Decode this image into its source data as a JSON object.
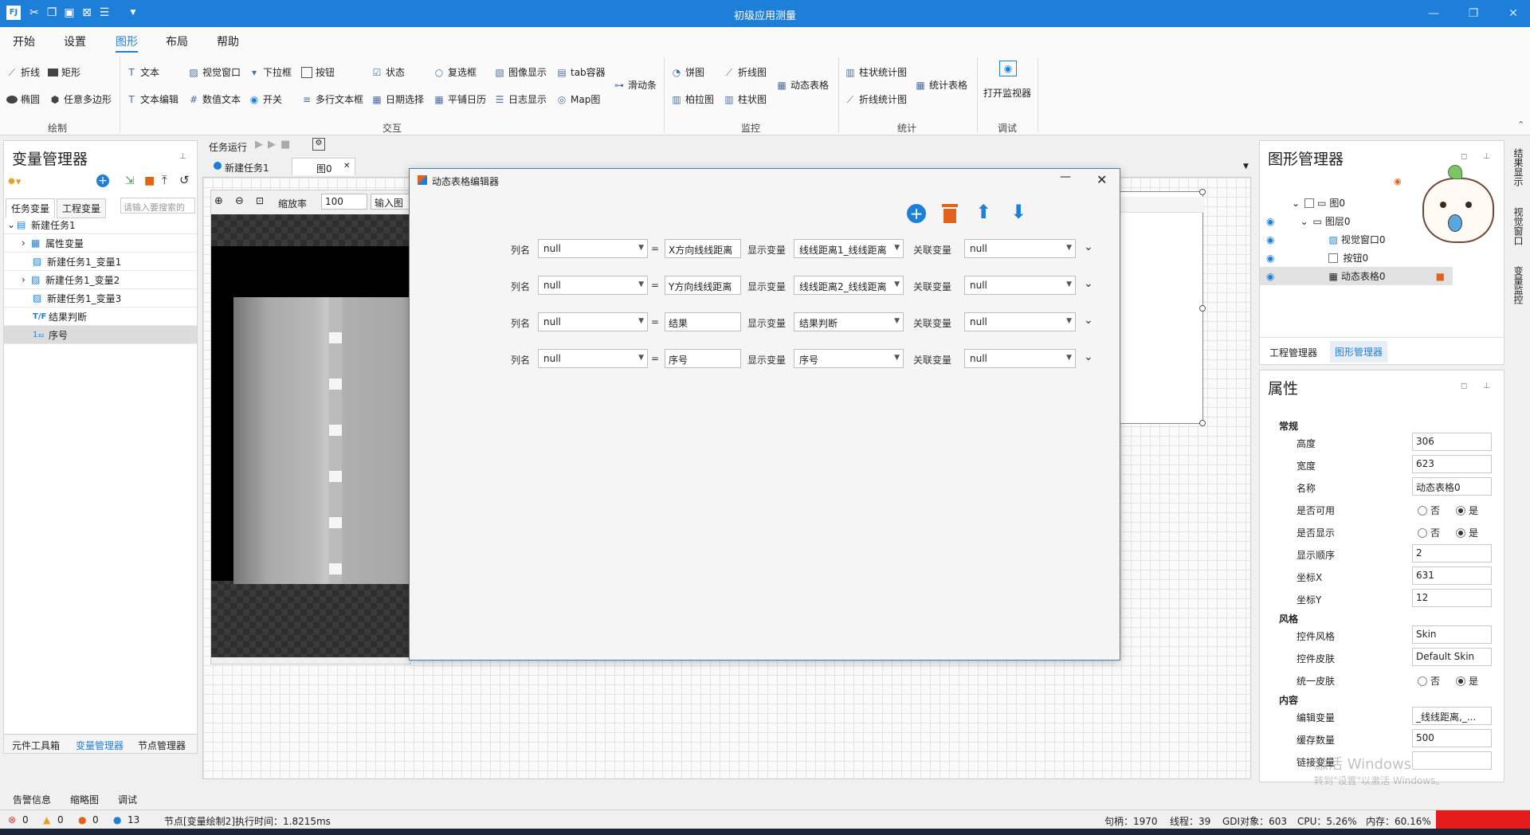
{
  "window": {
    "title": "初级应用测量"
  },
  "menu": [
    "开始",
    "设置",
    "图形",
    "布局",
    "帮助"
  ],
  "ribbon": {
    "draw": {
      "items": [
        "折线",
        "矩形",
        "椭圆",
        "任意多边形"
      ],
      "label": "绘制"
    },
    "interact": {
      "items": [
        "文本",
        "视觉窗口",
        "下拉框",
        "按钮",
        "状态",
        "复选框",
        "图像显示",
        "tab容器",
        "滑动条",
        "文本编辑",
        "数值文本",
        "开关",
        "多行文本框",
        "日期选择",
        "平铺日历",
        "日志显示",
        "Map图"
      ],
      "label": "交互"
    },
    "monitor": {
      "items": [
        "饼图",
        "折线图",
        "动态表格",
        "柏拉图",
        "柱状图"
      ],
      "label": "监控"
    },
    "stats": {
      "items": [
        "柱状统计图",
        "统计表格",
        "折线统计图"
      ],
      "label": "统计"
    },
    "debug": {
      "items": [
        "打开监视器"
      ],
      "label": "调试"
    }
  },
  "left_panel": {
    "title": "变量管理器",
    "tabs": [
      "任务变量",
      "工程变量"
    ],
    "search_placeholder": "请输入要搜索的",
    "tree": [
      "新建任务1",
      "属性变量",
      "新建任务1_变量1",
      "新建任务1_变量2",
      "新建任务1_变量3",
      "结果判断",
      "序号"
    ],
    "bottom_tabs": [
      "元件工具箱",
      "变量管理器",
      "节点管理器"
    ]
  },
  "center": {
    "toolbar_label": "任务运行",
    "doc_tabs": [
      "新建任务1",
      "图0"
    ],
    "zoom_label": "缩放率",
    "zoom_value": "100",
    "input_label": "输入图"
  },
  "dialog": {
    "title": "动态表格编辑器",
    "col_label": "列名",
    "eq": "=",
    "display_label": "显示变量",
    "assoc_label": "关联变量",
    "rows": [
      {
        "colname": "null",
        "text": "X方向线线距离",
        "display": "线线距离1_线线距离",
        "assoc": "null"
      },
      {
        "colname": "null",
        "text": "Y方向线线距离",
        "display": "线线距离2_线线距离",
        "assoc": "null"
      },
      {
        "colname": "null",
        "text": "结果",
        "display": "结果判断",
        "assoc": "null"
      },
      {
        "colname": "null",
        "text": "序号",
        "display": "序号",
        "assoc": "null"
      }
    ]
  },
  "right_panel": {
    "title": "图形管理器",
    "tree": [
      "图0",
      "图层0",
      "视觉窗口0",
      "按钮0",
      "动态表格0"
    ],
    "tabs": [
      "工程管理器",
      "图形管理器"
    ],
    "side_tabs": [
      "结果显示",
      "视觉窗口",
      "变量监控"
    ]
  },
  "props": {
    "title": "属性",
    "general": "常规",
    "height_label": "高度",
    "height": "306",
    "width_label": "宽度",
    "width": "623",
    "name_label": "名称",
    "name": "动态表格0",
    "enabled_label": "是否可用",
    "visible_label": "是否显示",
    "order_label": "显示顺序",
    "order": "2",
    "x_label": "坐标X",
    "x": "631",
    "y_label": "坐标Y",
    "y": "12",
    "no": "否",
    "yes": "是",
    "style": "风格",
    "ctrl_style_label": "控件风格",
    "ctrl_style": "Skin",
    "skin_label": "控件皮肤",
    "skin": "Default Skin",
    "unify_label": "统一皮肤",
    "content": "内容",
    "edit_var_label": "编辑变量",
    "edit_var": "_线线距离,_...",
    "cache_label": "缓存数量",
    "cache": "500",
    "link_label": "链接变量",
    "watermark1": "激活 Windows",
    "watermark2": "转到\"设置\"以激活 Windows。"
  },
  "bottom_tabs": [
    "告警信息",
    "缩略图",
    "调试"
  ],
  "status": {
    "err": "0",
    "warn": "0",
    "stop": "0",
    "info": "13",
    "message": "节点[变量绘制2]执行时间：1.8215ms",
    "handles": "句柄：1970",
    "threads": "线程：39",
    "gdi": "GDI对象：603",
    "cpu": "CPU：5.26%",
    "mem": "内存：60.16%"
  },
  "colors": {
    "accent": "#1e7fd8",
    "delete": "#e0621b"
  }
}
